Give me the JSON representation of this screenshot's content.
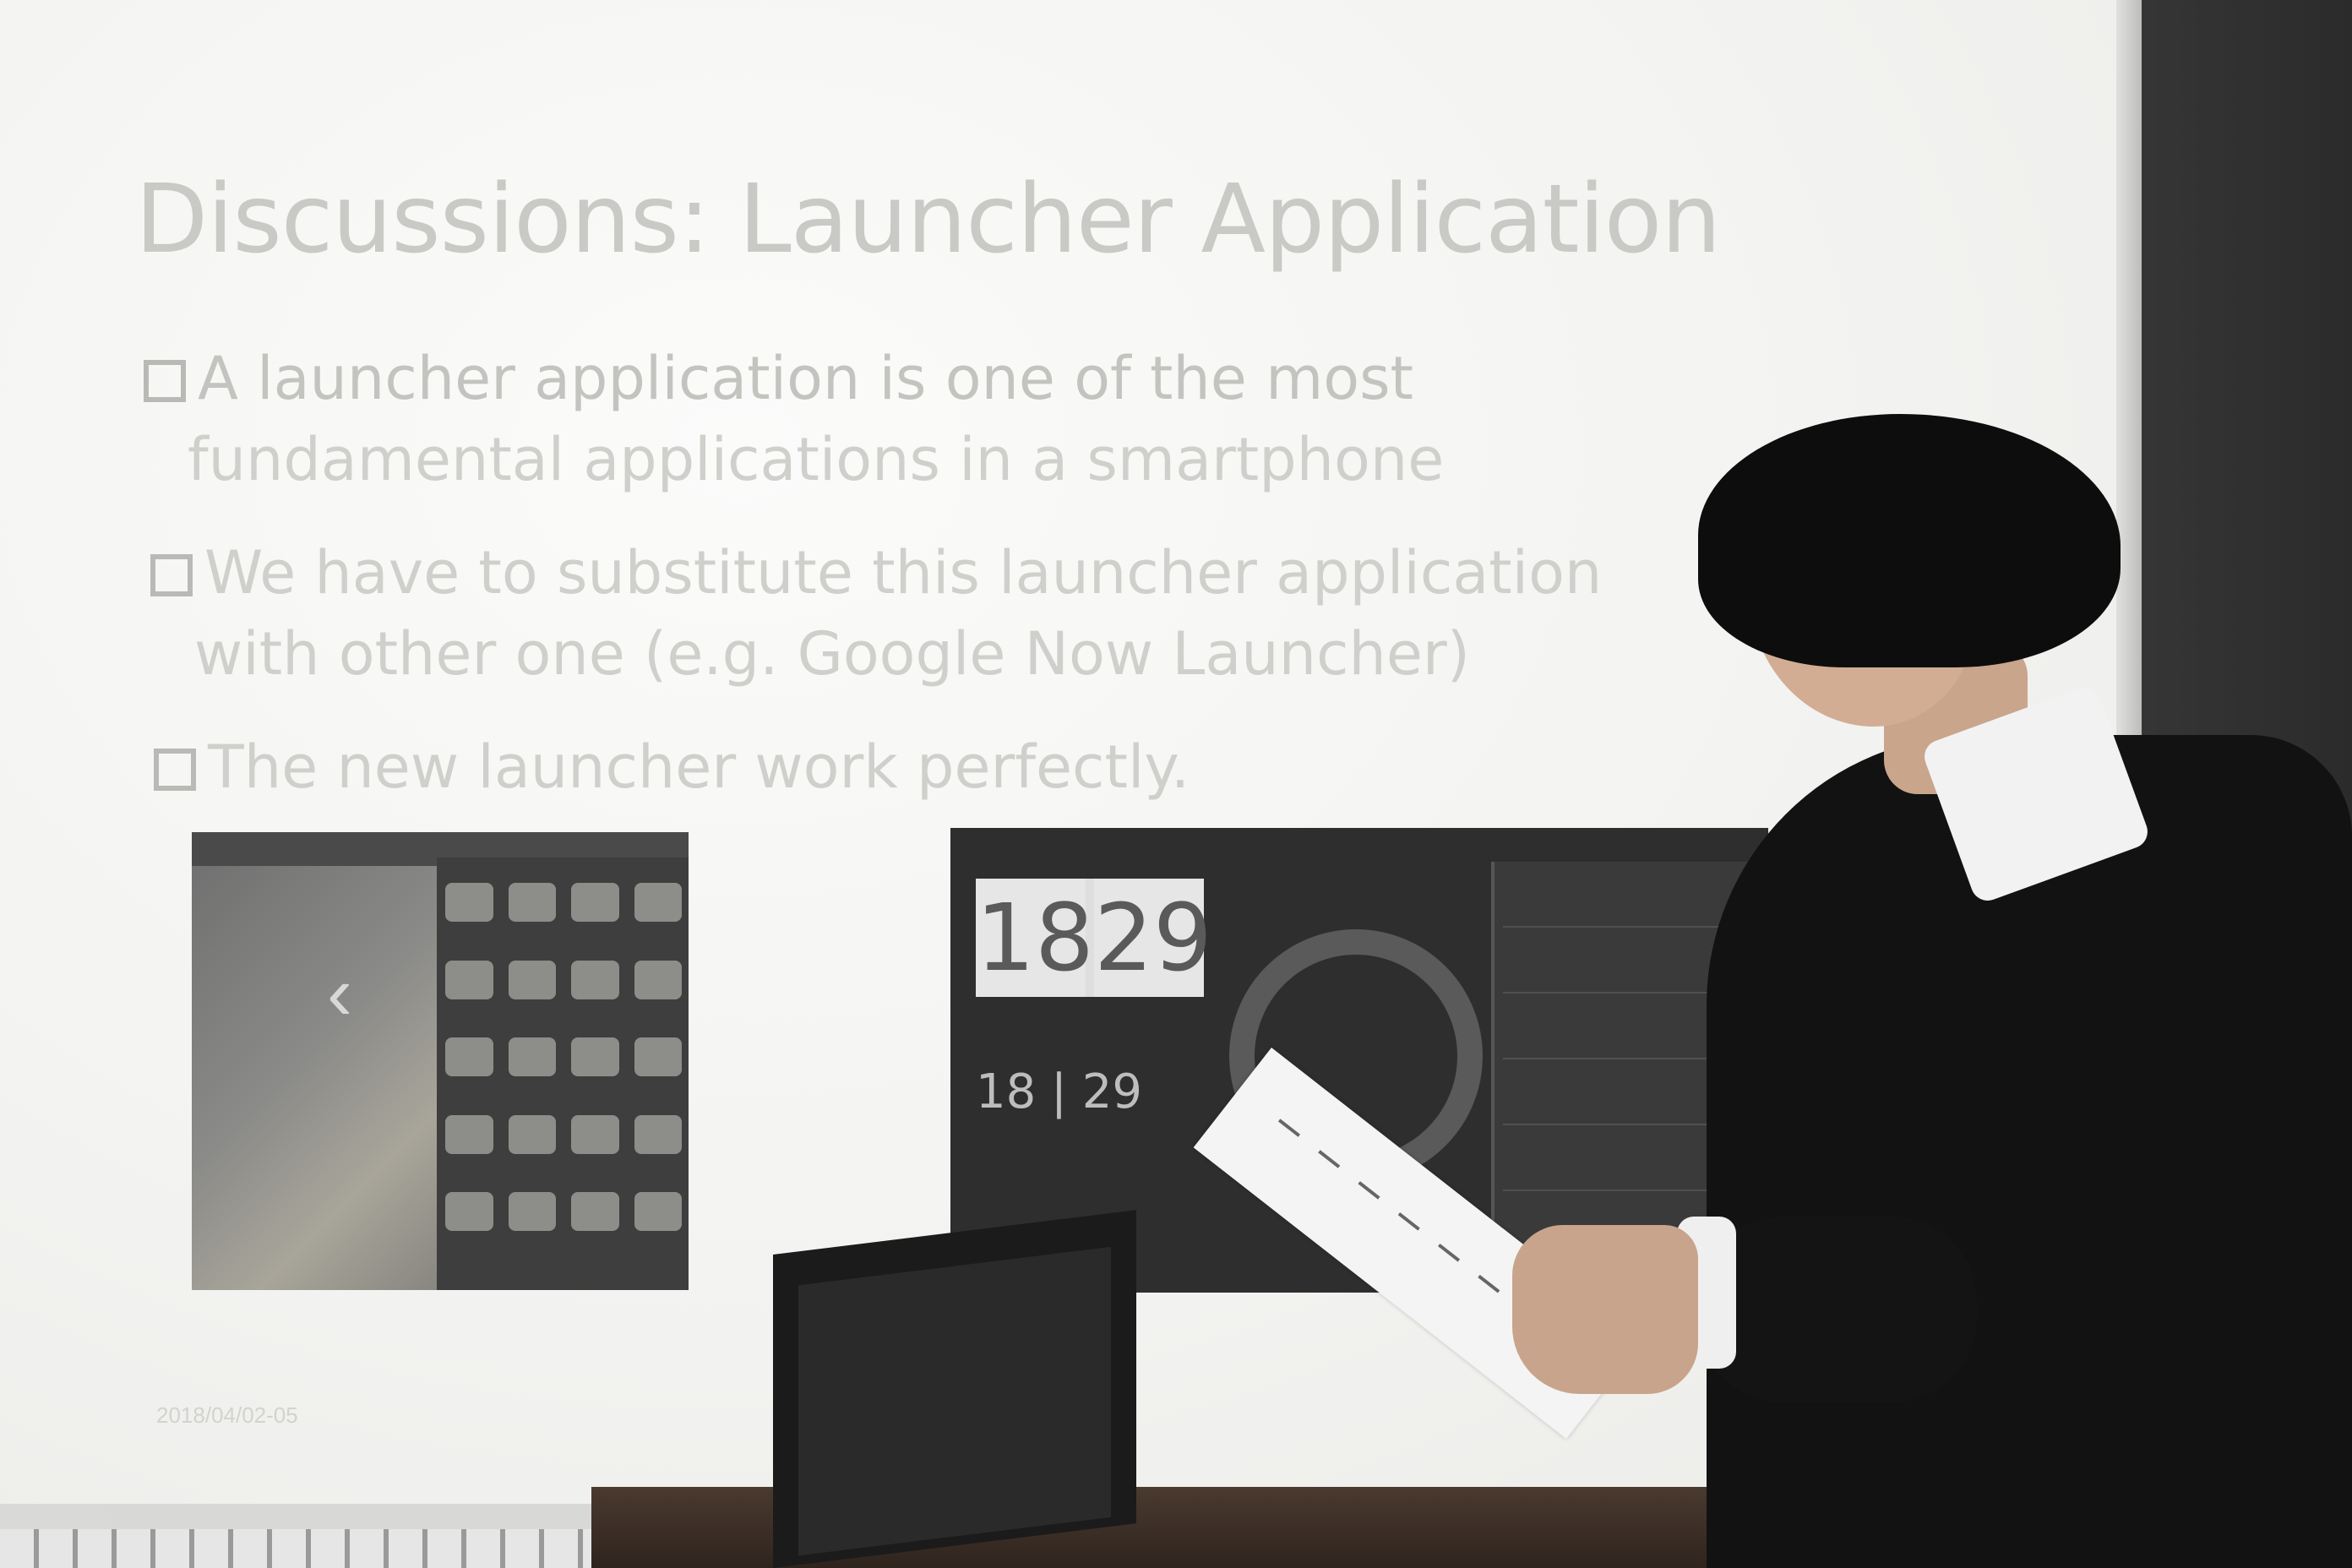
{
  "slide": {
    "title": "Discussions: Launcher Application",
    "bullets": [
      {
        "line1": "A launcher application is one of the most",
        "line2": "fundamental applications in a smartphone"
      },
      {
        "line1": "We have to substitute this launcher application",
        "line2": "with other one (e.g. Google Now Launcher)"
      },
      {
        "line1": "The new launcher work perfectly.",
        "line2": ""
      }
    ],
    "footer_date": "2018/04/02-05",
    "screenshot_clock_hour": "18",
    "screenshot_clock_minute": "29",
    "screenshot_small_time": "18 | 29"
  }
}
